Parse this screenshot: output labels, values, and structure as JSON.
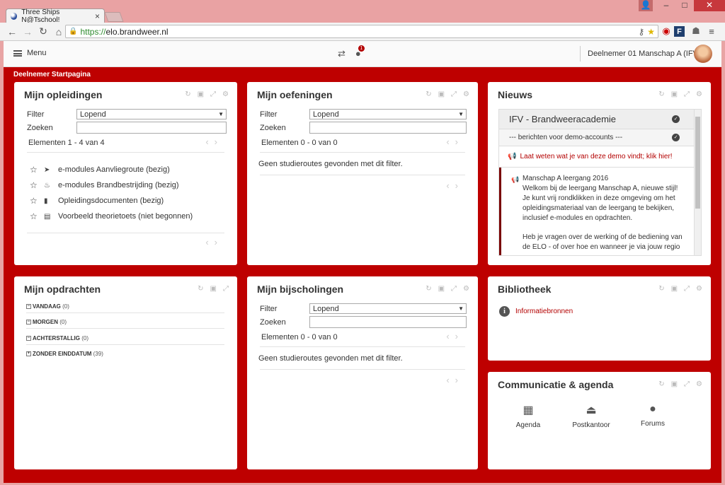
{
  "browser": {
    "tab_title": "Three Ships N@Tschool!",
    "url_scheme": "https://",
    "url_host": "elo.brandweer.nl"
  },
  "header": {
    "menu_label": "Menu",
    "notification_count": "1",
    "user_name": "Deelnemer 01 Manschap A (IFV)"
  },
  "breadcrumb": "Deelnemer Startpagina",
  "opleidingen": {
    "title": "Mijn opleidingen",
    "filter_label": "Filter",
    "filter_value": "Lopend",
    "search_label": "Zoeken",
    "count": "Elementen 1 - 4 van 4",
    "items": [
      {
        "label": "e-modules Aanvliegroute (bezig)",
        "icon": "paper-plane-icon"
      },
      {
        "label": "e-modules Brandbestrijding (bezig)",
        "icon": "fire-icon"
      },
      {
        "label": "Opleidingsdocumenten (bezig)",
        "icon": "book-icon"
      },
      {
        "label": "Voorbeeld theorietoets (niet begonnen)",
        "icon": "test-icon"
      }
    ]
  },
  "oefeningen": {
    "title": "Mijn oefeningen",
    "filter_label": "Filter",
    "filter_value": "Lopend",
    "search_label": "Zoeken",
    "count": "Elementen 0 - 0 van 0",
    "empty": "Geen studieroutes gevonden met dit filter."
  },
  "nieuws": {
    "title": "Nieuws",
    "group": "IFV - Brandweeracademie",
    "sub": "--- berichten voor demo-accounts ---",
    "link": "Laat weten wat je van deze demo vindt; klik hier!",
    "item_title": "Manschap A leergang 2016",
    "item_body": "Welkom bij de leergang Manschap A, nieuwe stijl! Je kunt vrij rondklikken in deze omgeving om het opleidingsmateriaal van de leergang te bekijken, inclusief e-modules en opdrachten.",
    "item_body2": "Heb je vragen over de werking of de bediening van de ELO - of over hoe en wanneer je via jouw regio"
  },
  "opdrachten": {
    "title": "Mijn opdrachten",
    "categories": [
      {
        "label": "VANDAAG",
        "count": "(0)",
        "sign": "−"
      },
      {
        "label": "MORGEN",
        "count": "(0)",
        "sign": "−"
      },
      {
        "label": "ACHTERSTALLIG",
        "count": "(0)",
        "sign": "−"
      },
      {
        "label": "ZONDER EINDDATUM",
        "count": "(39)",
        "sign": "+"
      }
    ]
  },
  "bijscholingen": {
    "title": "Mijn bijscholingen",
    "filter_label": "Filter",
    "filter_value": "Lopend",
    "search_label": "Zoeken",
    "count": "Elementen 0 - 0 van 0",
    "empty": "Geen studieroutes gevonden met dit filter."
  },
  "bibliotheek": {
    "title": "Bibliotheek",
    "link": "Informatiebronnen"
  },
  "communicatie": {
    "title": "Communicatie & agenda",
    "items": [
      {
        "label": "Agenda",
        "icon": "calendar-icon"
      },
      {
        "label": "Postkantoor",
        "icon": "inbox-icon"
      },
      {
        "label": "Forums",
        "icon": "chat-icon"
      }
    ]
  },
  "colors": {
    "brand": "#be0000",
    "link": "#b30000"
  }
}
